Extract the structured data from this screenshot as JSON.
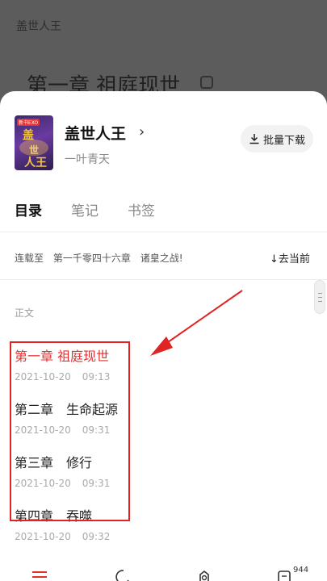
{
  "background": {
    "book_name": "盖世人王",
    "chapter_heading": "第一章 祖庭现世"
  },
  "book": {
    "title": "盖世人王",
    "author": "一叶青天",
    "cover_tag": "新书EXO",
    "cover_title_chars": [
      "盖",
      "世",
      "人王"
    ]
  },
  "actions": {
    "batch_download": "批量下载"
  },
  "tabs": [
    {
      "label": "目录",
      "active": true
    },
    {
      "label": "笔记",
      "active": false
    },
    {
      "label": "书签",
      "active": false
    }
  ],
  "serial": {
    "prefix": "连载至",
    "chapter": "第一千零四十六章",
    "name": "诸皇之战!"
  },
  "goto_current": "↓去当前",
  "section_label": "正文",
  "chapters": [
    {
      "title": "第一章 祖庭现世",
      "date": "2021-10-20",
      "time": "09:13",
      "current": true
    },
    {
      "title": "第二章　生命起源",
      "date": "2021-10-20",
      "time": "09:31",
      "current": false
    },
    {
      "title": "第三章　修行",
      "date": "2021-10-20",
      "time": "09:31",
      "current": false
    },
    {
      "title": "第四章　吞噬",
      "date": "2021-10-20",
      "time": "09:32",
      "current": false
    }
  ],
  "bottom_bar": {
    "badge_count": "944",
    "icons": [
      "catalog-icon",
      "night-mode-icon",
      "settings-icon",
      "comment-icon"
    ]
  },
  "colors": {
    "accent_red": "#e23030",
    "highlight_red": "#e02424",
    "overlay": "#5c5c5c"
  }
}
